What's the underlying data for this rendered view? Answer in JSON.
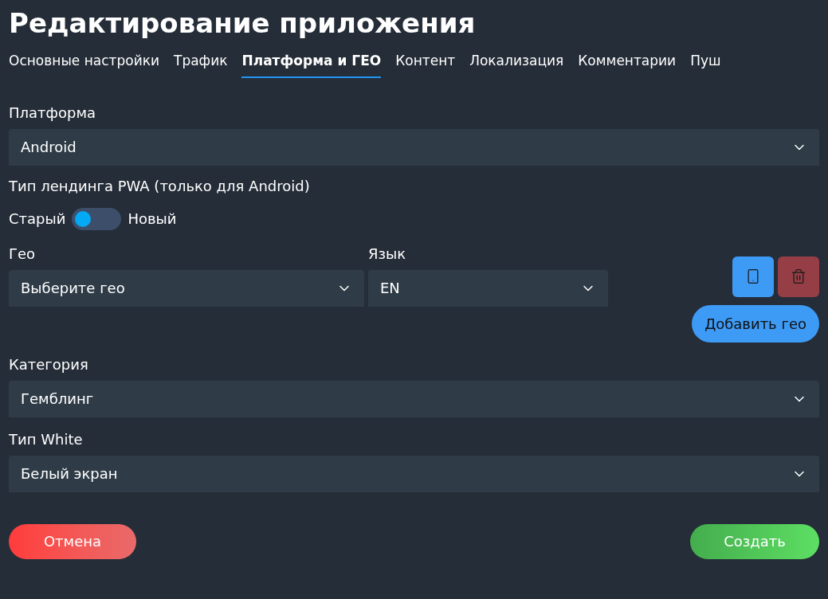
{
  "title": "Редактирование приложения",
  "tabs": [
    {
      "label": "Основные настройки",
      "selected": false
    },
    {
      "label": "Трафик",
      "selected": false
    },
    {
      "label": "Платформа и ГЕО",
      "selected": true
    },
    {
      "label": "Контент",
      "selected": false
    },
    {
      "label": "Локализация",
      "selected": false
    },
    {
      "label": "Комментарии",
      "selected": false
    },
    {
      "label": "Пуш",
      "selected": false
    }
  ],
  "platform": {
    "label": "Платформа",
    "value": "Android"
  },
  "pwa_type": {
    "label": "Тип лендинга PWA (только для Android)",
    "off_label": "Старый",
    "on_label": "Новый",
    "on": false
  },
  "geo": {
    "label": "Гео",
    "placeholder": "Выберите гео"
  },
  "language": {
    "label": "Язык",
    "value": "EN"
  },
  "add_geo": "Добавить гео",
  "category": {
    "label": "Категория",
    "value": "Гемблинг"
  },
  "white_type": {
    "label": "Тип White",
    "value": "Белый экран"
  },
  "buttons": {
    "cancel": "Отмена",
    "create": "Создать"
  }
}
